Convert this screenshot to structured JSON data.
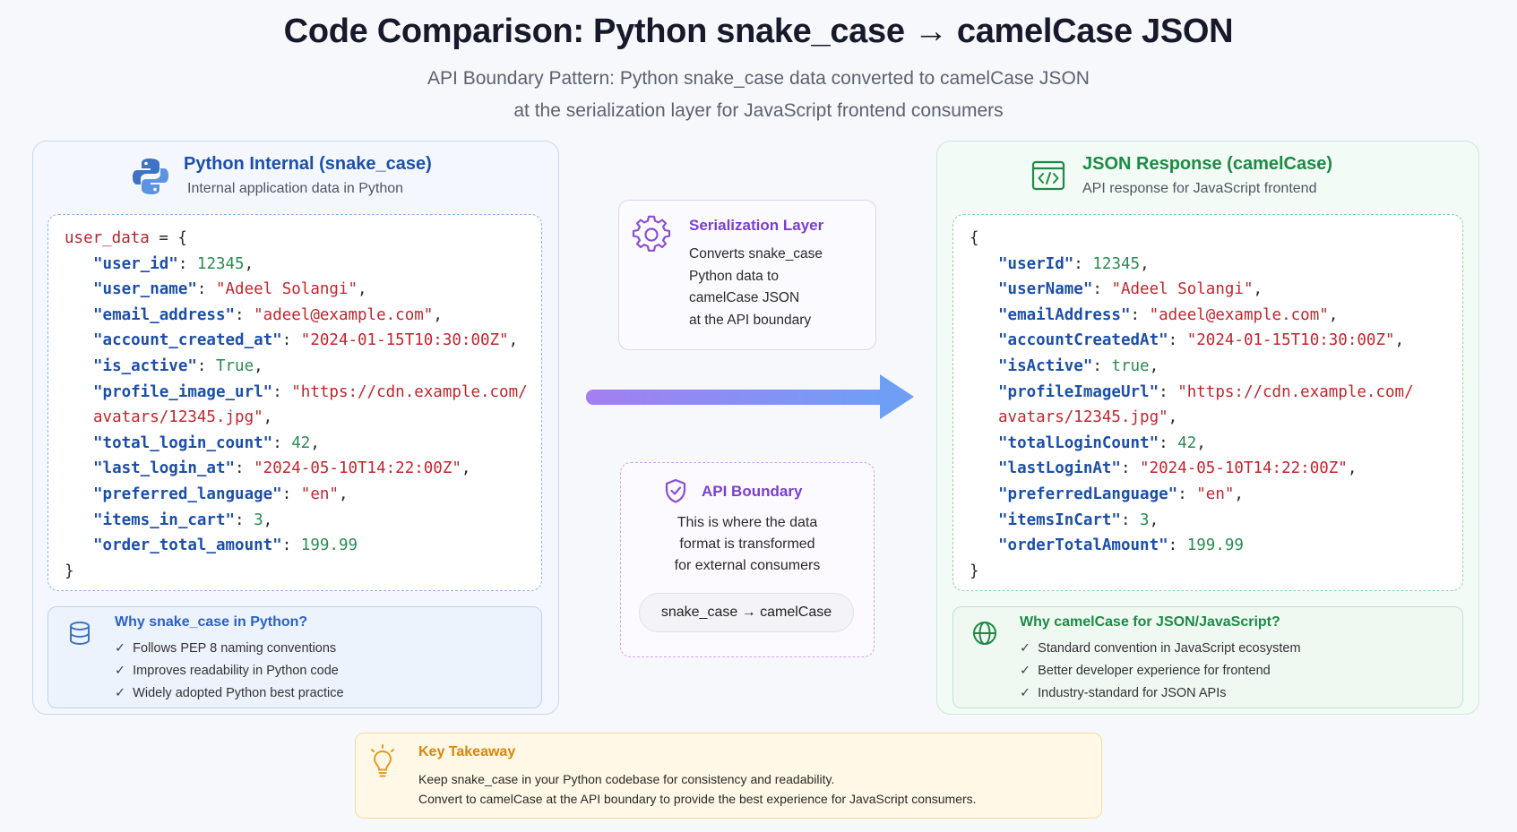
{
  "header": {
    "title": "Code Comparison: Python snake_case → camelCase JSON",
    "subtitle_line1": "API Boundary Pattern: Python snake_case data converted to camelCase JSON",
    "subtitle_line2": "at the serialization layer for JavaScript frontend consumers"
  },
  "left_panel": {
    "title": "Python Internal (snake_case)",
    "description": "Internal application data in Python",
    "code": {
      "open_var": "user_data",
      "open_rest": " = {",
      "lines": [
        {
          "key": "\"user_id\"",
          "value": "12345",
          "type": "n",
          "comma": ","
        },
        {
          "key": "\"user_name\"",
          "value": "\"Adeel Solangi\"",
          "type": "s",
          "comma": ","
        },
        {
          "key": "\"email_address\"",
          "value": "\"adeel@example.com\"",
          "type": "s",
          "comma": ","
        },
        {
          "key": "\"account_created_at\"",
          "value": "\"2024-01-15T10:30:00Z\"",
          "type": "s",
          "comma": ","
        },
        {
          "key": "\"is_active\"",
          "value": "True",
          "type": "n",
          "comma": ","
        },
        {
          "key": "\"profile_image_url\"",
          "value": "\"https://cdn.example.com/",
          "type": "s",
          "comma": ""
        },
        {
          "key": "",
          "value": "avatars/12345.jpg\"",
          "type": "s",
          "comma": ","
        },
        {
          "key": "\"total_login_count\"",
          "value": "42",
          "type": "n",
          "comma": ","
        },
        {
          "key": "\"last_login_at\"",
          "value": "\"2024-05-10T14:22:00Z\"",
          "type": "s",
          "comma": ","
        },
        {
          "key": "\"preferred_language\"",
          "value": "\"en\"",
          "type": "s",
          "comma": ","
        },
        {
          "key": "\"items_in_cart\"",
          "value": "3",
          "type": "n",
          "comma": ","
        },
        {
          "key": "\"order_total_amount\"",
          "value": "199.99",
          "type": "n",
          "comma": ""
        }
      ],
      "close": "}"
    },
    "why": {
      "title": "Why snake_case in Python?",
      "items": [
        "Follows PEP 8 naming conventions",
        "Improves readability in Python code",
        "Widely adopted Python best practice"
      ]
    }
  },
  "right_panel": {
    "title": "JSON Response (camelCase)",
    "description": "API response for JavaScript frontend",
    "code": {
      "open": "{",
      "lines": [
        {
          "key": "\"userId\"",
          "value": "12345",
          "type": "n",
          "comma": ","
        },
        {
          "key": "\"userName\"",
          "value": "\"Adeel Solangi\"",
          "type": "s",
          "comma": ","
        },
        {
          "key": "\"emailAddress\"",
          "value": "\"adeel@example.com\"",
          "type": "s",
          "comma": ","
        },
        {
          "key": "\"accountCreatedAt\"",
          "value": "\"2024-01-15T10:30:00Z\"",
          "type": "s",
          "comma": ","
        },
        {
          "key": "\"isActive\"",
          "value": "true",
          "type": "n",
          "comma": ","
        },
        {
          "key": "\"profileImageUrl\"",
          "value": "\"https://cdn.example.com/",
          "type": "s",
          "comma": ""
        },
        {
          "key": "",
          "value": "avatars/12345.jpg\"",
          "type": "s",
          "comma": ","
        },
        {
          "key": "\"totalLoginCount\"",
          "value": "42",
          "type": "n",
          "comma": ","
        },
        {
          "key": "\"lastLoginAt\"",
          "value": "\"2024-05-10T14:22:00Z\"",
          "type": "s",
          "comma": ","
        },
        {
          "key": "\"preferredLanguage\"",
          "value": "\"en\"",
          "type": "s",
          "comma": ","
        },
        {
          "key": "\"itemsInCart\"",
          "value": "3",
          "type": "n",
          "comma": ","
        },
        {
          "key": "\"orderTotalAmount\"",
          "value": "199.99",
          "type": "n",
          "comma": ""
        }
      ],
      "close": "}"
    },
    "why": {
      "title": "Why camelCase for JSON/JavaScript?",
      "items": [
        "Standard convention in JavaScript ecosystem",
        "Better developer experience for frontend",
        "Industry-standard for JSON APIs"
      ]
    }
  },
  "serialization": {
    "title": "Serialization Layer",
    "text": "Converts snake_case\nPython data to\ncamelCase JSON\nat the API boundary"
  },
  "api_boundary": {
    "title": "API Boundary",
    "text": "This is where the data\nformat is transformed\nfor external consumers",
    "pill": "snake_case → camelCase"
  },
  "takeaway": {
    "title": "Key Takeaway",
    "text": "Keep snake_case in your Python codebase for consistency and readability.\nConvert to camelCase at the API boundary to provide the best experience for JavaScript consumers."
  },
  "colors": {
    "python_blue": "#1d4fa8",
    "json_green": "#1d8a45",
    "serialization_purple": "#7a3fd0",
    "takeaway_orange": "#d8860c",
    "arrow_start": "#a37ff0",
    "arrow_end": "#6f9ff5"
  },
  "icons": {
    "left_panel": "python-logo-icon",
    "right_panel": "code-window-icon",
    "serialization": "gear-icon",
    "api_boundary": "shield-check-icon",
    "why_left": "database-icon",
    "why_right": "globe-icon",
    "takeaway": "lightbulb-icon"
  }
}
